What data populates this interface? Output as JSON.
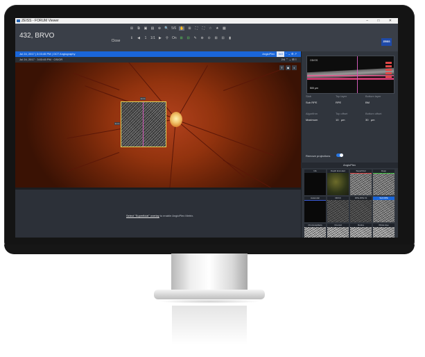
{
  "app": {
    "title": "ZEISS - FORUM Viewer",
    "window_controls": "– □ ✕",
    "patient": "432, BRVO",
    "close_label": "Close",
    "brand": "ZEISS"
  },
  "toolbar": {
    "row1": [
      "⊞",
      "⧉",
      "▣",
      "▤",
      "⊕",
      "🔍",
      "5/6",
      "✋",
      "⊞",
      "⛶",
      "⛶",
      "☆",
      "★",
      "▦"
    ],
    "row2": [
      "ℹ",
      "◀",
      "1",
      "1/1",
      "▶",
      "⚲",
      "On",
      "⊞",
      "⊟",
      "✎",
      "⊛",
      "⊙",
      "⊞",
      "⊟",
      "▮"
    ],
    "accent_green": "#5bd25b"
  },
  "bluebar": {
    "left": "Jul 24, 2017  |  3:03:45 PM  |  OCT Angiography",
    "angio_label": "AngioPlex",
    "angio_badge": "3x3",
    "right": "⌃  ⌄  ⚙  ↗"
  },
  "infobar": {
    "left": "Jul 24, 2017  ·  3:03:45 PM  ·  OS/OR",
    "right": "2/4  ⌃  ⌄  ⊞  ≡"
  },
  "fundus": {
    "tools": [
      "T",
      "◆",
      "◐"
    ],
    "marker_top": "1mm",
    "marker_left": "1mm"
  },
  "hint": {
    "link": "Select \"Superficial\" overlay",
    "rest": " to enable AngioPlex Metrix."
  },
  "bscan": {
    "label": "OD/OS",
    "scale": "500 µm"
  },
  "fields": [
    {
      "left_label": "Slab",
      "left_value": "Sub RPE",
      "mid_label": "Top layer",
      "mid_value": "RPE",
      "right_label": "Bottom layer",
      "right_value": "BM"
    },
    {
      "left_label": "Algorithm",
      "left_value": "Maximum",
      "mid_label": "Top offset",
      "mid_value": "10",
      "mid_unit": "µm",
      "right_label": "Bottom offset",
      "right_value": "30",
      "right_unit": "µm"
    }
  ],
  "toggle": {
    "label": "Remove projections",
    "state": "on"
  },
  "angio": {
    "header": "AngioPlex",
    "tiles": [
      {
        "label": "NA",
        "style": "dark"
      },
      {
        "label": "Depth Encoded",
        "style": "color"
      },
      {
        "label": "Superficial",
        "style": "mid",
        "bar": "#e04848"
      },
      {
        "label": "Deep",
        "style": "mid",
        "bar": "#42c242"
      },
      {
        "label": "Avascular",
        "style": "dark",
        "bar": "#3a5bd9"
      },
      {
        "label": "ORCC",
        "style": "dim"
      },
      {
        "label": "RPE-RPE Fit",
        "style": "dim"
      },
      {
        "label": "Sub RPE",
        "style": "mid",
        "selected": true
      },
      {
        "label": "Choriocapillaris",
        "style": "light"
      },
      {
        "label": "Choroid",
        "style": "light"
      },
      {
        "label": "Retina",
        "style": "light"
      },
      {
        "label": "Whole Eye",
        "style": "light"
      }
    ]
  }
}
